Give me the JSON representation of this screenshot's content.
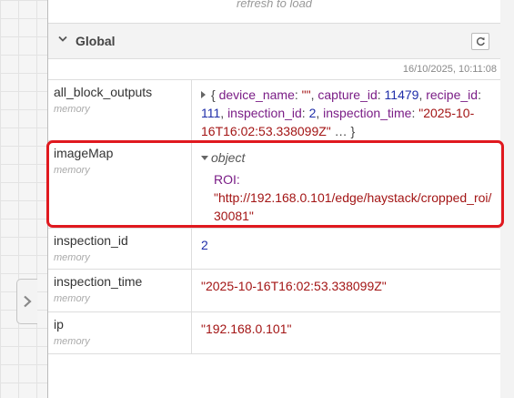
{
  "refresh_hint": "refresh to load",
  "section": {
    "title": "Global"
  },
  "timestamp": "16/10/2025, 10:11:08",
  "rows": [
    {
      "key": "all_block_outputs",
      "type": "memory",
      "value": {
        "open": "{",
        "entries": [
          {
            "k": "device_name",
            "v": "\"\""
          },
          {
            "k": "capture_id",
            "v": "11479"
          },
          {
            "k": "recipe_id",
            "v": "111"
          },
          {
            "k": "inspection_id",
            "v": "2"
          },
          {
            "k": "inspection_time",
            "v": "\"2025-10-16T16:02:53.338099Z\""
          }
        ],
        "close": "… }"
      }
    },
    {
      "key": "imageMap",
      "type": "memory",
      "value": {
        "type_label": "object",
        "child_key": "ROI:",
        "child_value": "\"http://192.168.0.101/edge/haystack/cropped_roi/30081\""
      }
    },
    {
      "key": "inspection_id",
      "type": "memory",
      "value": "2"
    },
    {
      "key": "inspection_time",
      "type": "memory",
      "value": "\"2025-10-16T16:02:53.338099Z\""
    },
    {
      "key": "ip",
      "type": "memory",
      "value": "\"192.168.0.101\""
    }
  ],
  "colors": {
    "highlight": "#e0191f",
    "string": "#a31515",
    "number": "#1f2ea9",
    "property": "#7a1d86"
  },
  "icons": {
    "section_toggle": "chevron-down-icon",
    "section_refresh": "refresh-icon",
    "sidebar_toggle": "chevron-right-icon",
    "collapsed_value": "caret-right-icon",
    "expanded_value": "caret-down-icon"
  }
}
